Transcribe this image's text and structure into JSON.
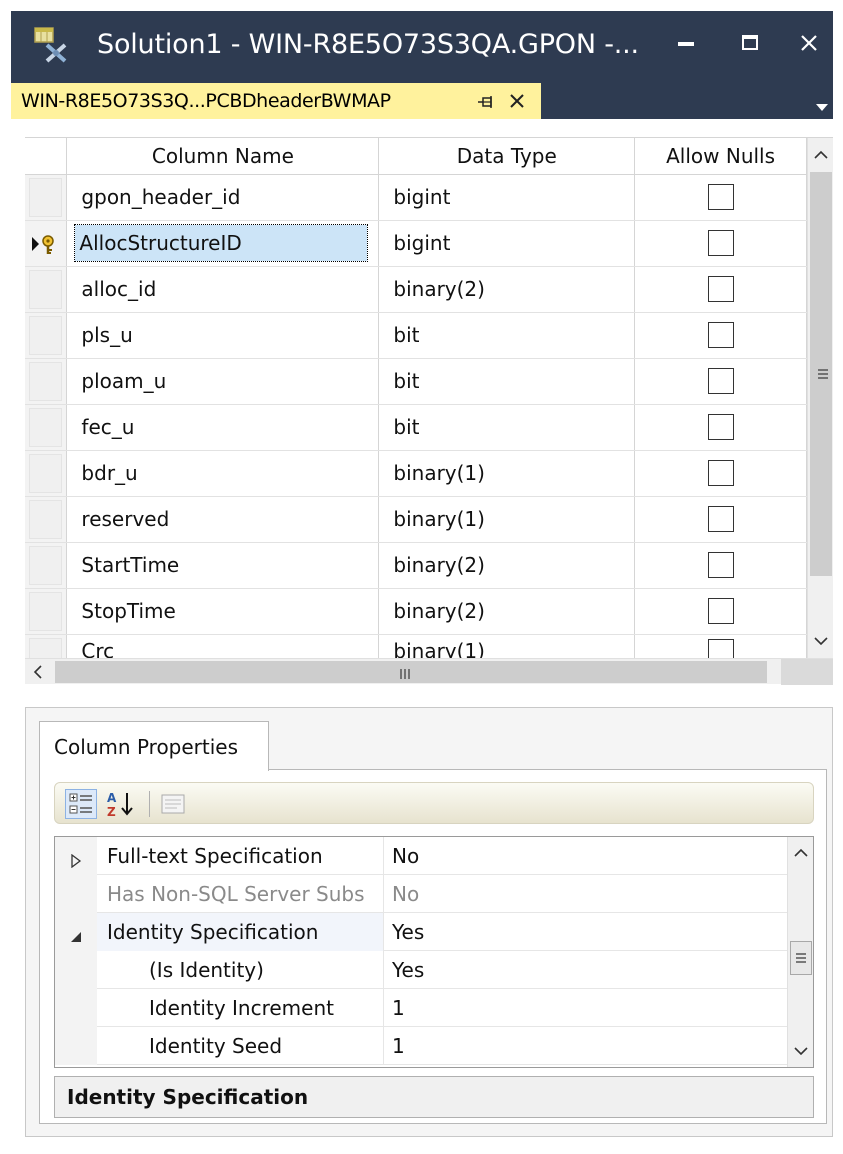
{
  "window": {
    "title": "Solution1 - WIN-R8E5O73S3QA.GPON -...",
    "title_color": "#ffffff",
    "chrome_color": "#2e3b51"
  },
  "tab": {
    "label": "WIN-R8E5O73S3Q...PCBDheaderBWMAP",
    "color": "#fff29d"
  },
  "grid": {
    "headers": {
      "name": "Column Name",
      "type": "Data Type",
      "nulls": "Allow Nulls"
    },
    "rows": [
      {
        "name": "gpon_header_id",
        "type": "bigint",
        "allow_nulls": false
      },
      {
        "name": "AllocStructureID",
        "type": "bigint",
        "allow_nulls": false,
        "primary_key": true,
        "selected": true
      },
      {
        "name": "alloc_id",
        "type": "binary(2)",
        "allow_nulls": false
      },
      {
        "name": "pls_u",
        "type": "bit",
        "allow_nulls": false
      },
      {
        "name": "ploam_u",
        "type": "bit",
        "allow_nulls": false
      },
      {
        "name": "fec_u",
        "type": "bit",
        "allow_nulls": false
      },
      {
        "name": "bdr_u",
        "type": "binary(1)",
        "allow_nulls": false
      },
      {
        "name": "reserved",
        "type": "binary(1)",
        "allow_nulls": false
      },
      {
        "name": "StartTime",
        "type": "binary(2)",
        "allow_nulls": false
      },
      {
        "name": "StopTime",
        "type": "binary(2)",
        "allow_nulls": false
      },
      {
        "name": "Crc",
        "type": "binary(1)",
        "allow_nulls": false
      }
    ],
    "selection_color": "#cce4f7"
  },
  "properties": {
    "tab_label": "Column Properties",
    "rows": [
      {
        "name": "Full-text Specification",
        "value": "No",
        "expander": "collapsed",
        "indent": 0
      },
      {
        "name": "Has Non-SQL Server Subs",
        "value": "No",
        "disabled": true,
        "indent": 0
      },
      {
        "name": "Identity Specification",
        "value": "Yes",
        "expander": "expanded",
        "indent": 0,
        "highlight": true
      },
      {
        "name": "(Is Identity)",
        "value": "Yes",
        "indent": 1
      },
      {
        "name": "Identity Increment",
        "value": "1",
        "indent": 1
      },
      {
        "name": "Identity Seed",
        "value": "1",
        "indent": 1
      }
    ],
    "description_title": "Identity Specification"
  }
}
